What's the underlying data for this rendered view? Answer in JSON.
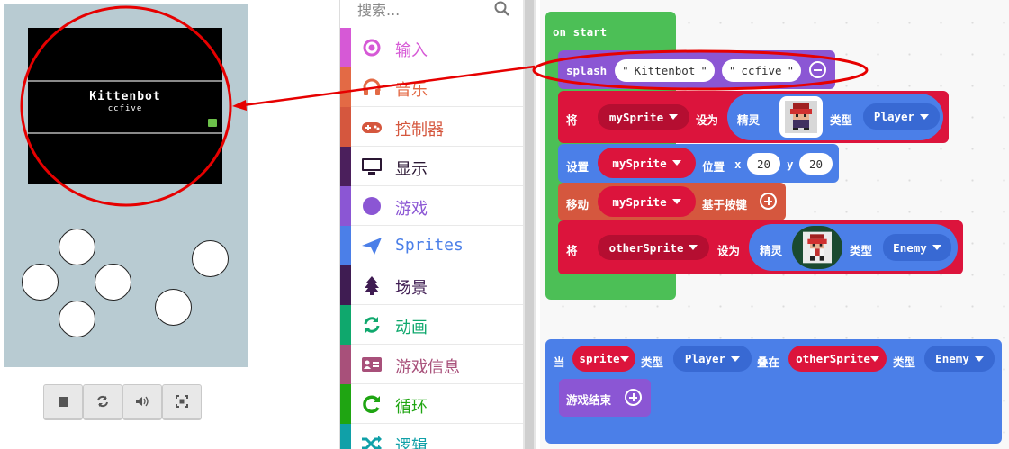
{
  "simulator": {
    "screen": {
      "title": "Kittenbot",
      "subtitle": "ccfive"
    },
    "controls": [
      "stop-icon",
      "restart-icon",
      "sound-icon",
      "fullscreen-icon"
    ]
  },
  "toolbox": {
    "search_placeholder": "搜索...",
    "categories": [
      {
        "label": "输入",
        "color": "#d659d6",
        "icon": "radio-circle-icon"
      },
      {
        "label": "音乐",
        "color": "#e36a45",
        "icon": "headphones-icon"
      },
      {
        "label": "控制器",
        "color": "#d5573e",
        "icon": "gamepad-icon"
      },
      {
        "label": "显示",
        "color": "#4b1f5c",
        "icon": "monitor-icon"
      },
      {
        "label": "游戏",
        "color": "#8b56d4",
        "icon": "circle-icon"
      },
      {
        "label": "Sprites",
        "color": "#4b7fe8",
        "icon": "paper-plane-icon"
      },
      {
        "label": "场景",
        "color": "#3f1c52",
        "icon": "tree-icon"
      },
      {
        "label": "动画",
        "color": "#0fa86d",
        "icon": "refresh-icon"
      },
      {
        "label": "游戏信息",
        "color": "#a8507a",
        "icon": "id-card-icon"
      },
      {
        "label": "循环",
        "color": "#1fa512",
        "icon": "loop-icon"
      },
      {
        "label": "逻辑",
        "color": "#10a0a8",
        "icon": "shuffle-icon"
      }
    ]
  },
  "workspace": {
    "on_start": "on start",
    "splash": {
      "label": "splash",
      "arg1": "Kittenbot",
      "arg2": "ccfive"
    },
    "set_sprite": {
      "label": "将",
      "var": "mySprite",
      "set_to": "设为",
      "sprite": "精灵",
      "type_label": "类型",
      "type": "Player"
    },
    "set_position": {
      "label": "设置",
      "var": "mySprite",
      "pos": "位置",
      "x_label": "x",
      "x": "20",
      "y_label": "y",
      "y": "20"
    },
    "move": {
      "label": "移动",
      "var": "mySprite",
      "with": "基于按键"
    },
    "set_other": {
      "label": "将",
      "var": "otherSprite",
      "set_to": "设为",
      "sprite": "精灵",
      "type_label": "类型",
      "type": "Enemy"
    },
    "overlap": {
      "when": "当",
      "a": "sprite",
      "type_label1": "类型",
      "type1": "Player",
      "overlaps": "叠在",
      "b": "otherSprite",
      "type_label2": "类型",
      "type2": "Enemy"
    },
    "game_over": "游戏结束"
  },
  "colors": {
    "event_green": "#4cbf56",
    "splash_purple": "#8b56d4",
    "set_red": "#dc143c",
    "sprite_blue": "#4b7fe8",
    "controller_orange": "#d5573e",
    "annotation_red": "#e60000"
  }
}
